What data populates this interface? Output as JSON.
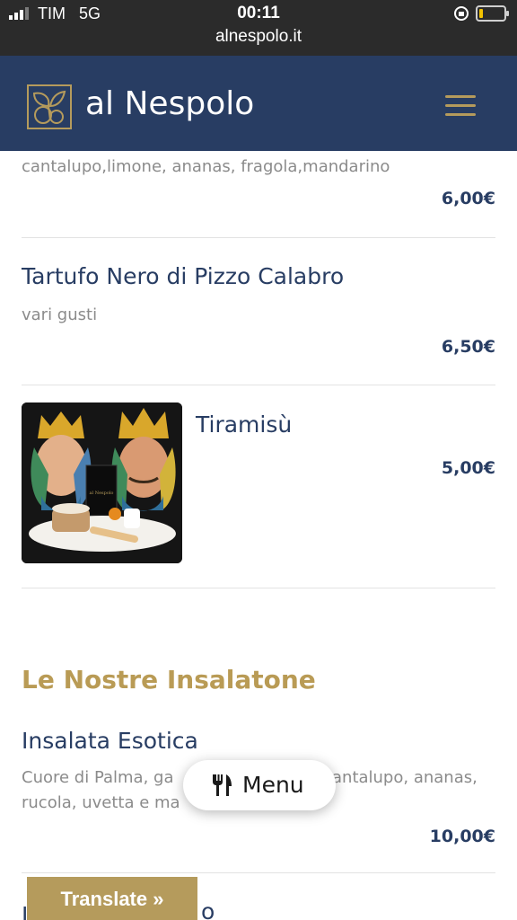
{
  "status_bar": {
    "carrier": "TIM",
    "network": "5G",
    "time": "00:11",
    "url": "alnespolo.it",
    "battery_level": 0.15
  },
  "header": {
    "brand": "al Nespolo",
    "logo_icon": "nespolo-leaf-logo-icon",
    "menu_icon": "hamburger-icon",
    "accent_color": "#b59b5c",
    "background_color": "#283d63"
  },
  "menu": {
    "item_top": {
      "description": "cantalupo,limone, ananas, fragola,mandarino",
      "price": "6,00€"
    },
    "item_tartufo": {
      "name": "Tartufo Nero di Pizzo Calabro",
      "description": "vari gusti",
      "price": "6,50€"
    },
    "item_tiramisu": {
      "name": "Tiramisù",
      "price": "5,00€",
      "photo_label": "al Nespolo"
    },
    "section_insalatone": {
      "title": "Le Nostre Insalatone"
    },
    "item_insalata_esotica": {
      "name": "Insalata Esotica",
      "description_line1": "Cuore di Palma, ga",
      "description_line1_end": "antalupo, ananas,",
      "description_line2": "rucola, uvetta e ma",
      "price": "10,00€"
    },
    "item_partial": {
      "name_start": "I",
      "name_end": "o"
    }
  },
  "floating_menu": {
    "label": "Menu",
    "icon": "fork-knife-icon"
  },
  "translate_button": {
    "label": "Translate »"
  }
}
